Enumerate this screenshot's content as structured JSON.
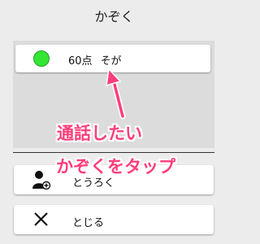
{
  "header": {
    "title": "かぞく"
  },
  "members": [
    {
      "score": "60点",
      "name": "そが",
      "status_color": "#33e633"
    }
  ],
  "buttons": {
    "register_label": "とうろく",
    "close_label": "とじる"
  },
  "annotation": {
    "line1": "通話したい",
    "line2": "かぞくをタップ",
    "color": "#ff3d7a"
  }
}
